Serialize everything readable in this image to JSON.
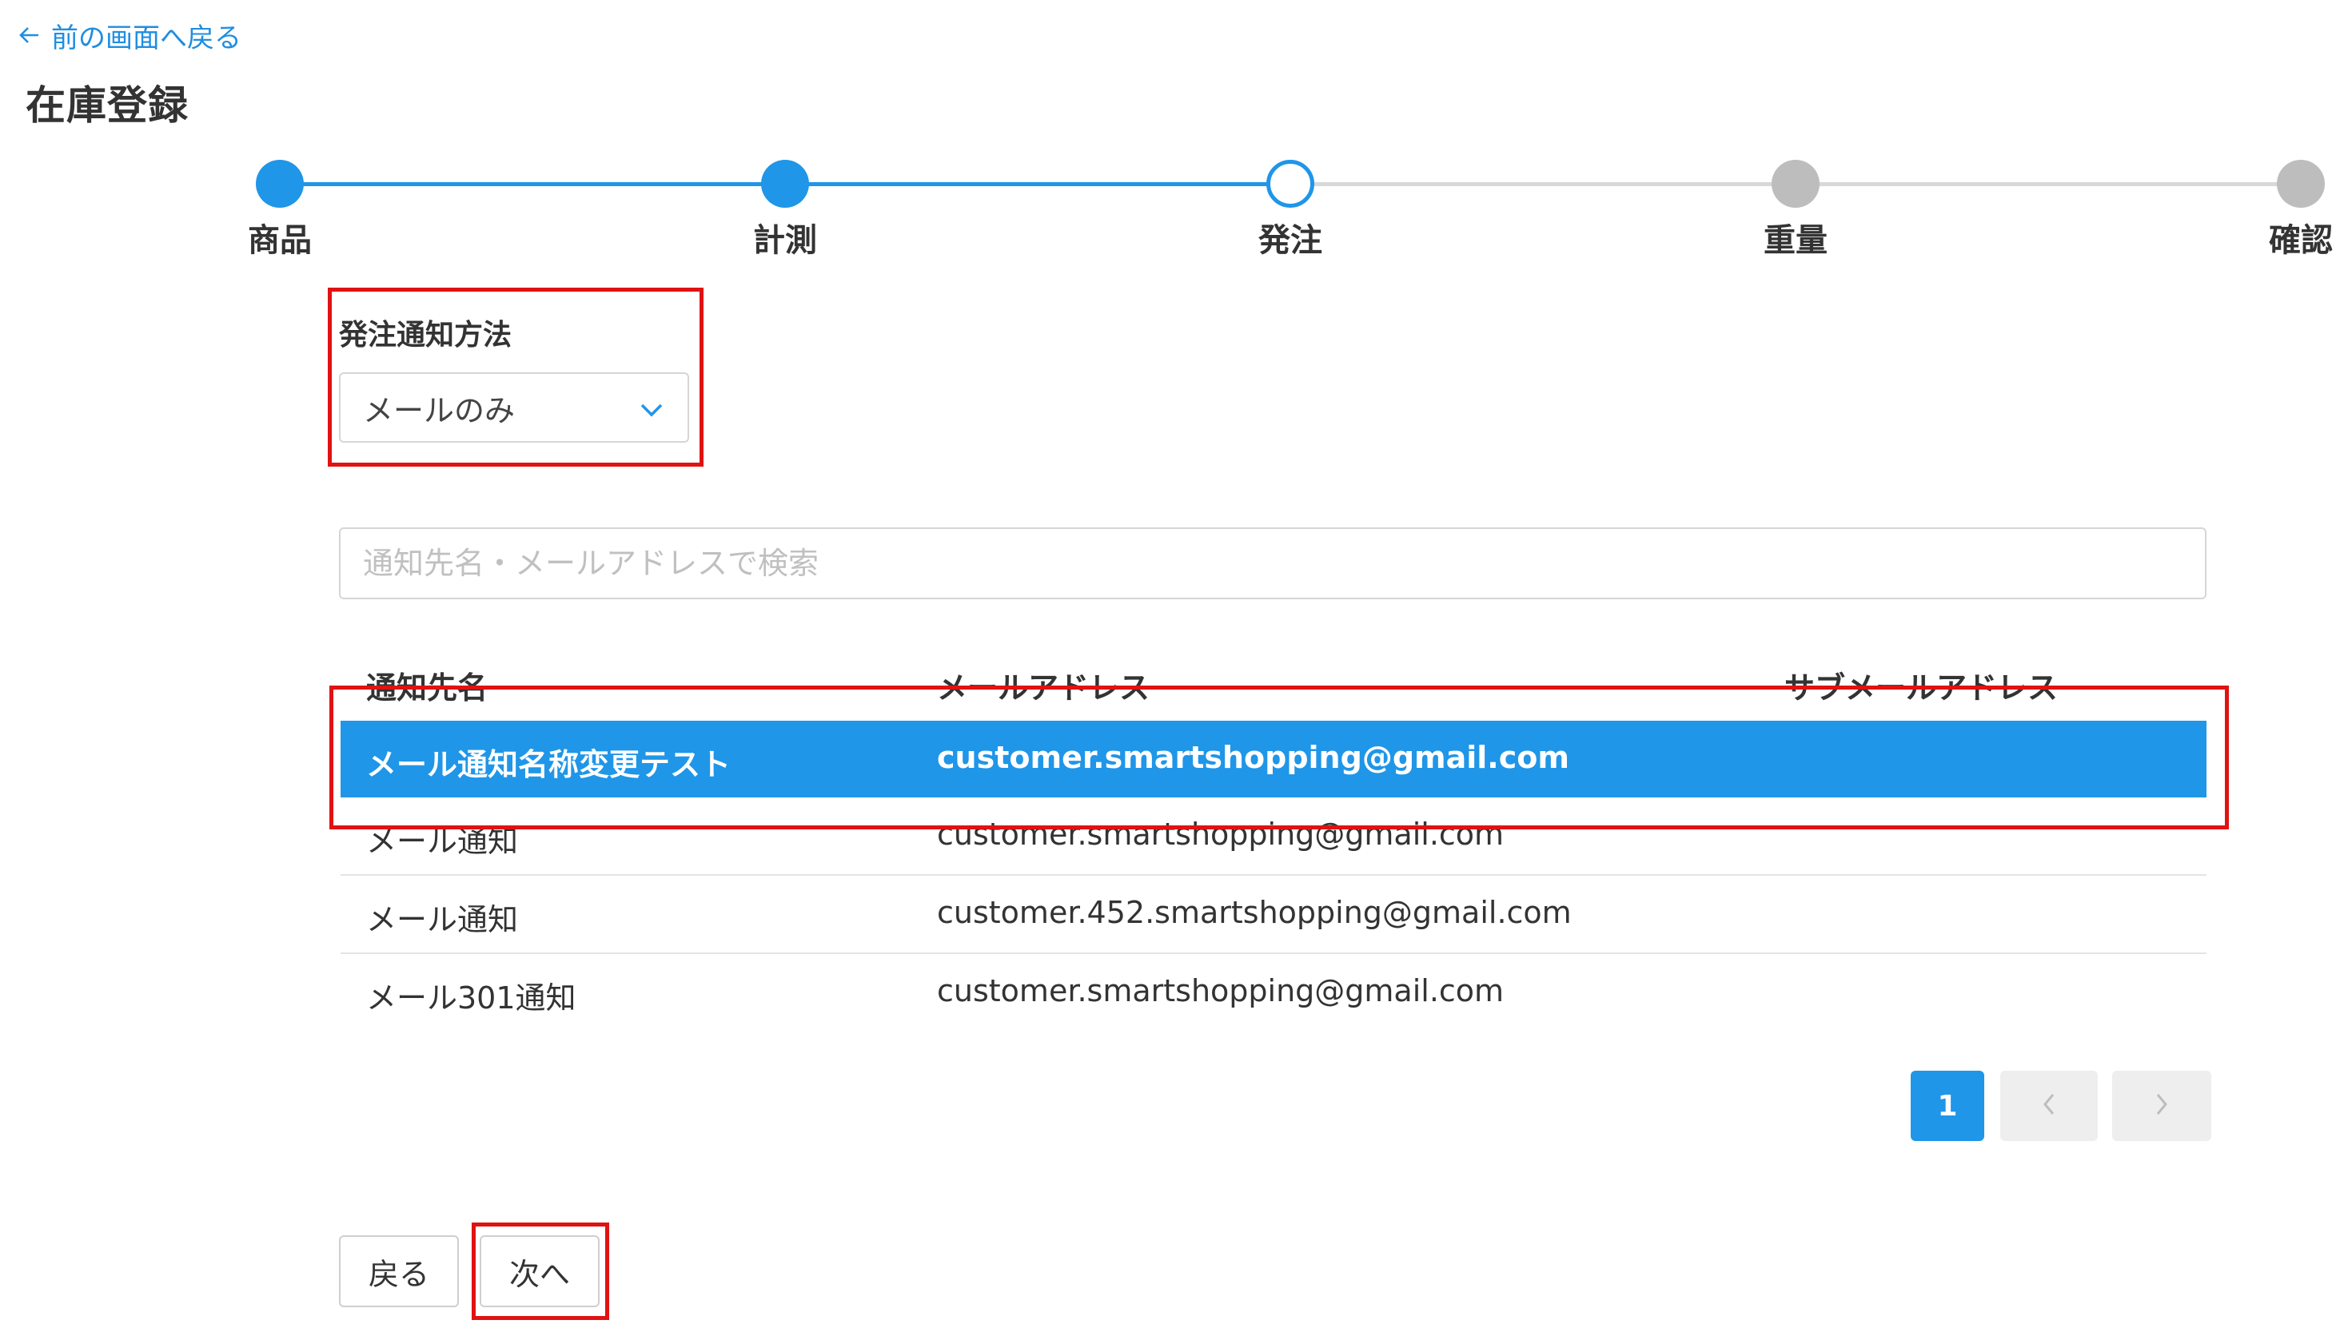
{
  "colors": {
    "accent": "#1f96e8",
    "inactive": "#bdbdbd",
    "highlight": "#e01212"
  },
  "nav": {
    "back_link": "前の画面へ戻る",
    "back_icon": "arrow-left-icon"
  },
  "page": {
    "title": "在庫登録"
  },
  "stepper": {
    "steps": [
      {
        "label": "商品",
        "state": "completed"
      },
      {
        "label": "計測",
        "state": "completed"
      },
      {
        "label": "発注",
        "state": "current"
      },
      {
        "label": "重量",
        "state": "pending"
      },
      {
        "label": "確認",
        "state": "pending"
      }
    ]
  },
  "notification_method": {
    "label": "発注通知方法",
    "selected": "メールのみ",
    "icon": "chevron-down-icon"
  },
  "search": {
    "placeholder": "通知先名・メールアドレスで検索",
    "value": ""
  },
  "table": {
    "headers": [
      "通知先名",
      "メールアドレス",
      "サブメールアドレス"
    ],
    "rows": [
      {
        "name": "メール通知名称変更テスト",
        "email": "customer.smartshopping@gmail.com",
        "sub_email": "",
        "selected": true
      },
      {
        "name": "メール通知",
        "email": "customer.smartshopping@gmail.com",
        "sub_email": "",
        "selected": false
      },
      {
        "name": "メール通知",
        "email": "customer.452.smartshopping@gmail.com",
        "sub_email": "",
        "selected": false
      },
      {
        "name": "メール301通知",
        "email": "customer.smartshopping@gmail.com",
        "sub_email": "",
        "selected": false
      }
    ]
  },
  "pagination": {
    "current_page": "1",
    "prev_icon": "chevron-left-icon",
    "next_icon": "chevron-right-icon"
  },
  "footer": {
    "back_label": "戻る",
    "next_label": "次へ"
  }
}
